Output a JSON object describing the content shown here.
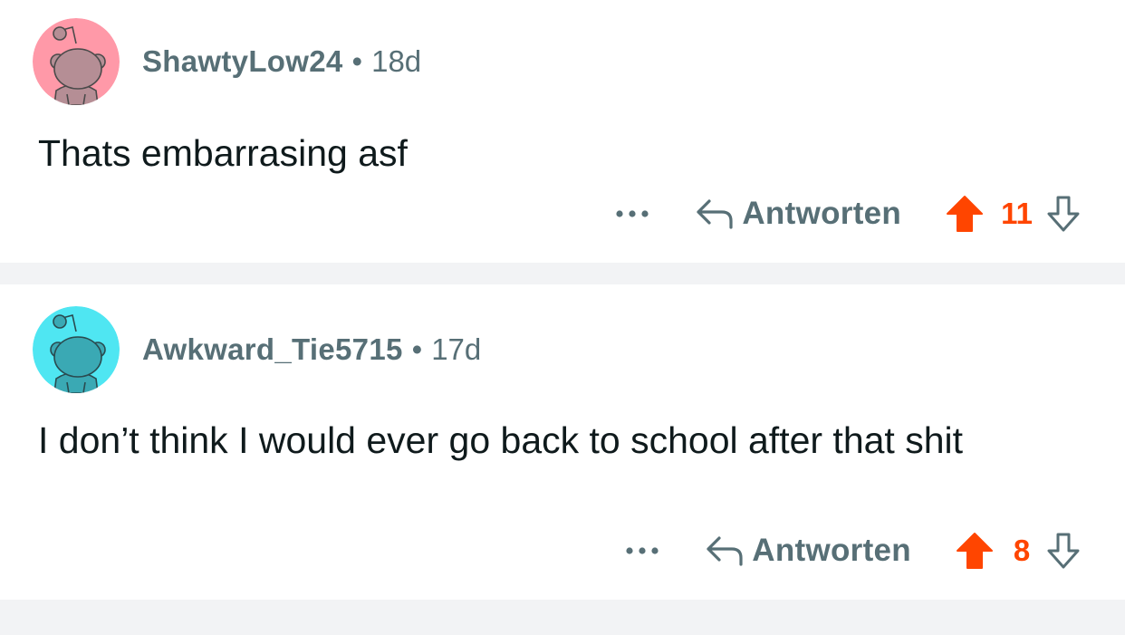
{
  "colors": {
    "upvote_active": "#ff4500",
    "meta_gray": "#576f76",
    "divider": "#f2f3f5",
    "avatar_pink_bg": "#ff99a8",
    "avatar_cyan_bg": "#4fe6f2"
  },
  "comments": [
    {
      "username": "ShawtyLow24",
      "separator": "•",
      "age": "18d",
      "text": "Thats embarrasing asf",
      "more_icon": "more-horizontal-icon",
      "reply_icon": "reply-arrow-icon",
      "reply_label": "Antworten",
      "upvote_icon": "upvote-arrow-icon",
      "score": "11",
      "downvote_icon": "downvote-arrow-icon",
      "avatar_icon": "snoo-avatar-icon"
    },
    {
      "username": "Awkward_Tie5715",
      "separator": "•",
      "age": "17d",
      "text": "I don’t think I would ever go back to school after that shit",
      "more_icon": "more-horizontal-icon",
      "reply_icon": "reply-arrow-icon",
      "reply_label": "Antworten",
      "upvote_icon": "upvote-arrow-icon",
      "score": "8",
      "downvote_icon": "downvote-arrow-icon",
      "avatar_icon": "snoo-avatar-icon"
    }
  ]
}
